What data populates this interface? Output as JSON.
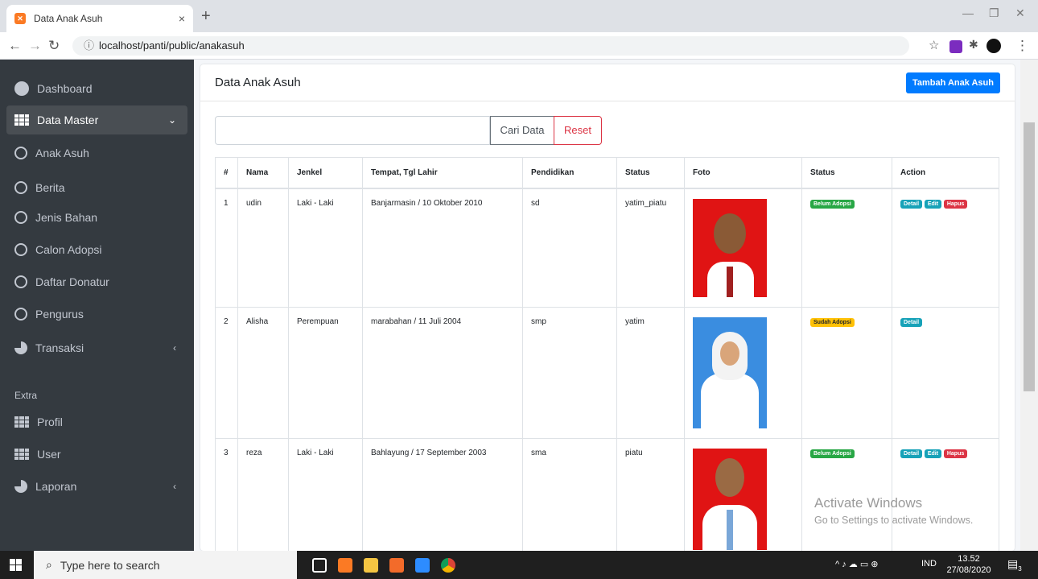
{
  "browser": {
    "tab_title": "Data Anak Asuh",
    "url": "localhost/panti/public/anakasuh"
  },
  "sidebar": {
    "items": [
      {
        "label": "Dashboard",
        "icon": "gauge-icon"
      },
      {
        "label": "Data Master",
        "icon": "grid-icon"
      },
      {
        "label": "Anak Asuh",
        "icon": "circle-icon"
      },
      {
        "label": "Berita",
        "icon": "circle-icon"
      },
      {
        "label": "Jenis Bahan",
        "icon": "circle-icon"
      },
      {
        "label": "Calon Adopsi",
        "icon": "circle-icon"
      },
      {
        "label": "Daftar Donatur",
        "icon": "circle-icon"
      },
      {
        "label": "Pengurus",
        "icon": "circle-icon"
      },
      {
        "label": "Transaksi",
        "icon": "pie-chart-icon"
      }
    ],
    "section_extra": "Extra",
    "extra_items": [
      {
        "label": "Profil",
        "icon": "grid-icon"
      },
      {
        "label": "User",
        "icon": "grid-icon"
      },
      {
        "label": "Laporan",
        "icon": "pie-chart-icon"
      }
    ]
  },
  "main": {
    "title": "Data Anak Asuh",
    "add_button": "Tambah Anak Asuh",
    "search_placeholder": "",
    "search_button": "Cari Data",
    "reset_button": "Reset",
    "columns": [
      "#",
      "Nama",
      "Jenkel",
      "Tempat, Tgl Lahir",
      "Pendidikan",
      "Status",
      "Foto",
      "Status",
      "Action"
    ],
    "rows": [
      {
        "no": "1",
        "nama": "udin",
        "jenkel": "Laki - Laki",
        "ttl": "Banjarmasin / 10 Oktober 2010",
        "pendidikan": "sd",
        "status": "yatim_piatu",
        "adopsi": "Belum Adopsi",
        "actions": [
          "Detail",
          "Edit",
          "Hapus"
        ]
      },
      {
        "no": "2",
        "nama": "Alisha",
        "jenkel": "Perempuan",
        "ttl": "marabahan / 11 Juli 2004",
        "pendidikan": "smp",
        "status": "yatim",
        "adopsi": "Sudah Adopsi",
        "actions": [
          "Detail"
        ]
      },
      {
        "no": "3",
        "nama": "reza",
        "jenkel": "Laki - Laki",
        "ttl": "Bahlayung / 17 September 2003",
        "pendidikan": "sma",
        "status": "piatu",
        "adopsi": "Belum Adopsi",
        "actions": [
          "Detail",
          "Edit",
          "Hapus"
        ]
      }
    ]
  },
  "watermark": {
    "line1": "Activate Windows",
    "line2": "Go to Settings to activate Windows."
  },
  "taskbar": {
    "search_placeholder": "Type here to search",
    "language": "IND",
    "time": "13.52",
    "date": "27/08/2020",
    "notification_count": "3"
  },
  "colors": {
    "sidebar_bg": "#343a40",
    "primary": "#007bff",
    "danger": "#dc3545",
    "success": "#28a745",
    "warning": "#ffc107",
    "info": "#17a2b8"
  }
}
